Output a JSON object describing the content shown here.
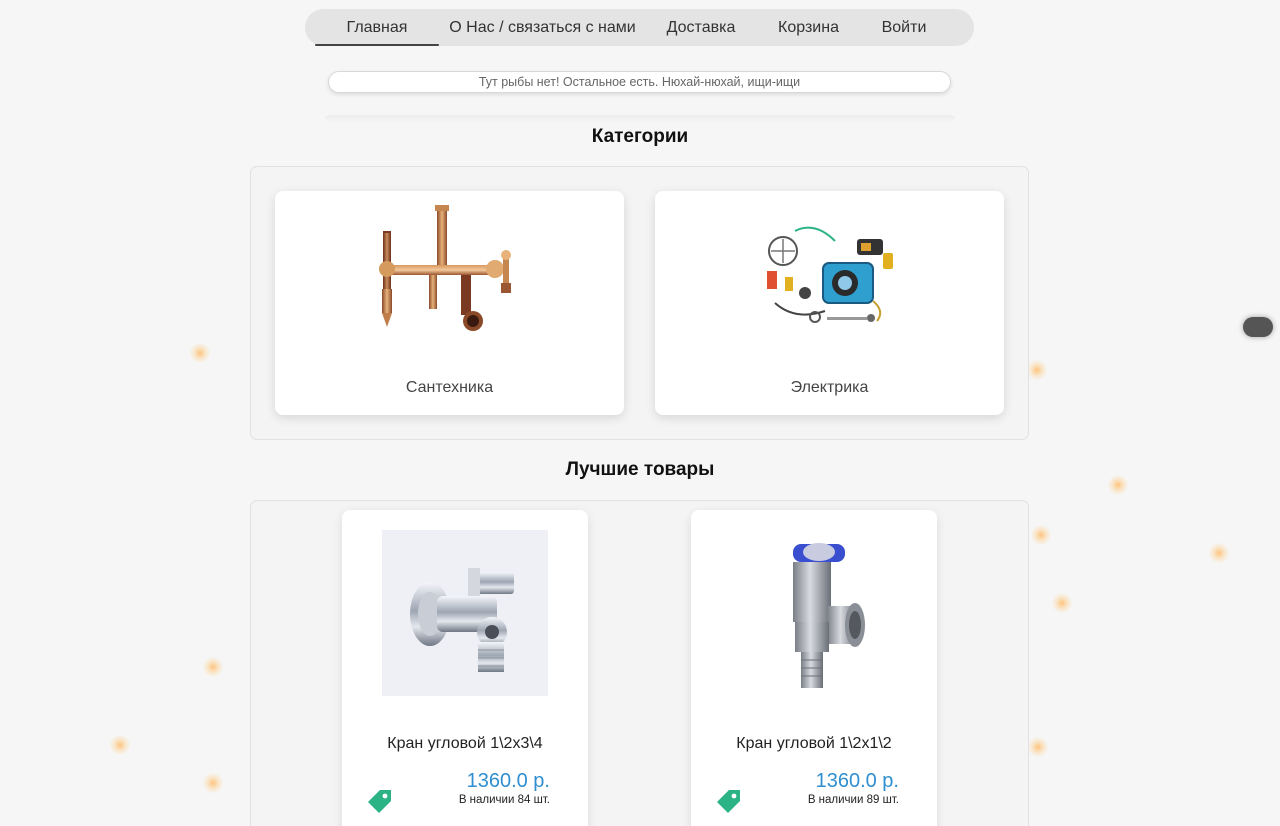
{
  "nav": {
    "items": [
      {
        "label": "Главная",
        "active": true
      },
      {
        "label": "О Нас / связаться с нами",
        "active": false
      },
      {
        "label": "Доставка",
        "active": false
      },
      {
        "label": "Корзина",
        "active": false
      },
      {
        "label": "Войти",
        "active": false
      }
    ]
  },
  "search": {
    "placeholder": "Тут рыбы нет! Остальное есть. Нюхай-нюхай, ищи-ищи",
    "value": ""
  },
  "categories": {
    "title": "Категории",
    "items": [
      {
        "label": "Сантехника",
        "icon": "plumbing-fixture-image"
      },
      {
        "label": "Электрика",
        "icon": "electrical-parts-image"
      }
    ]
  },
  "best": {
    "title": "Лучшие товары",
    "products": [
      {
        "name": "Кран угловой 1\\2x3\\4",
        "price": "1360.0 р.",
        "stock": "В наличии 84 шт.",
        "icon": "angle-valve-chrome-image"
      },
      {
        "name": "Кран угловой 1\\2x1\\2",
        "price": "1360.0 р.",
        "stock": "В наличии 89 шт.",
        "icon": "angle-valve-steel-image"
      }
    ]
  },
  "colors": {
    "accent_price": "#2f8fd0",
    "tag_icon": "#2bb386",
    "glow": "#ffb45a"
  }
}
